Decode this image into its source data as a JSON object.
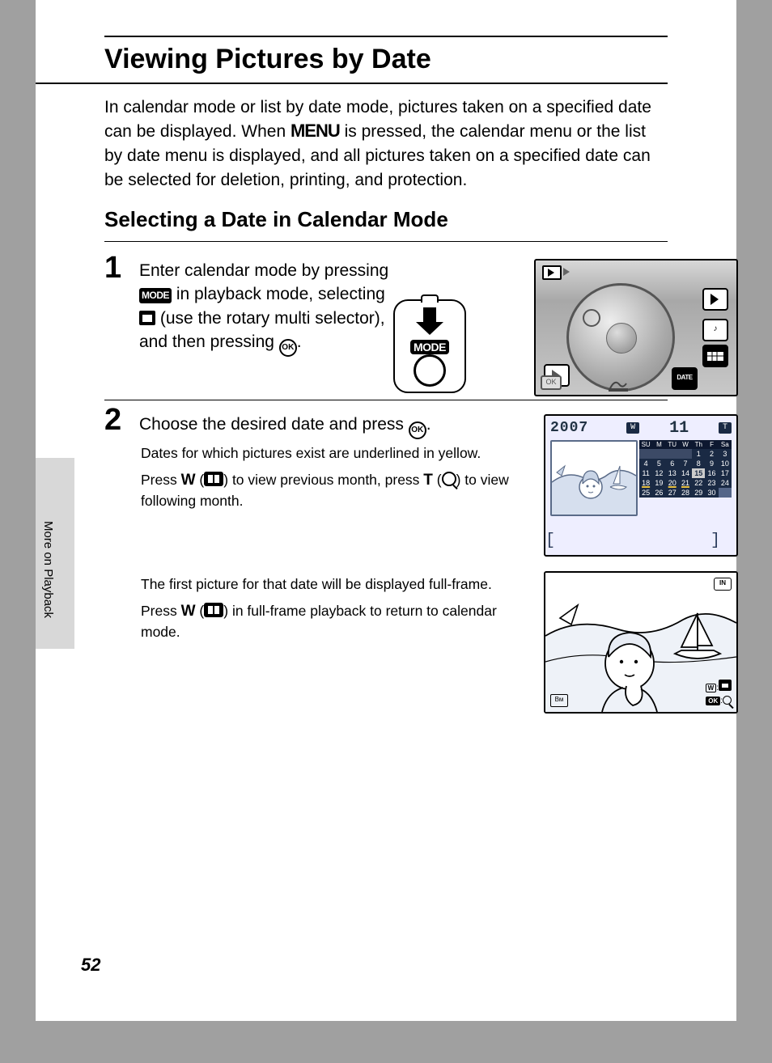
{
  "page_number": "52",
  "side_tab": "More on Playback",
  "title": "Viewing Pictures by Date",
  "intro_before_menu": "In calendar mode or list by date mode, pictures taken on a specified date can be displayed. When ",
  "menu_word": "MENU",
  "intro_after_menu": " is pressed, the calendar menu or the list by date menu is displayed, and all pictures taken on a specified date can be selected for deletion, printing, and protection.",
  "subtitle": "Selecting a Date in Calendar Mode",
  "steps": {
    "s1": {
      "num": "1",
      "line1": "Enter calendar mode by pressing ",
      "mode_chip": "MODE",
      "line2a": " in playback mode, selecting ",
      "line2b": " (use the rotary multi selector), and then pressing ",
      "period": "."
    },
    "s2": {
      "num": "2",
      "head_before": "Choose the desired date and press ",
      "head_after": ".",
      "body1": "Dates for which pictures exist are underlined in yellow.",
      "body2_a": "Press ",
      "body2_w": "W",
      "body2_b": " (",
      "body2_c": ") to view previous month, press ",
      "body2_t": "T",
      "body2_d": " (",
      "body2_e": ") to view following month.",
      "body3": "The first picture for that date will be displayed full-frame.",
      "body4_a": "Press ",
      "body4_w": "W",
      "body4_b": " (",
      "body4_c": ") in full-frame playback to return to calendar mode."
    }
  },
  "mode_illustration_label": "MODE",
  "lcd1": {
    "ok": "OK",
    "date_label": "DATE"
  },
  "lcd2": {
    "year": "2007",
    "w_chip": "W",
    "month": "11",
    "t_chip": "T",
    "dow": [
      "SU",
      "M",
      "TU",
      "W",
      "Th",
      "F",
      "Sa"
    ],
    "rows": [
      [
        "",
        "",
        "",
        "",
        "1",
        "2",
        "3"
      ],
      [
        "4",
        "5",
        "6",
        "7",
        "8",
        "9",
        "10"
      ],
      [
        "11",
        "12",
        "13",
        "14",
        "15",
        "16",
        "17"
      ],
      [
        "18",
        "19",
        "20",
        "21",
        "22",
        "23",
        "24"
      ],
      [
        "25",
        "26",
        "27",
        "28",
        "29",
        "30",
        ""
      ]
    ],
    "underlined": [
      "18",
      "20",
      "21"
    ],
    "selected": "15"
  },
  "lcd3": {
    "in": "IN",
    "bm": "Bм",
    "hint1_l": "W",
    "hint1_r": ":",
    "hint2_l": "OK",
    "hint2_r": ":"
  }
}
